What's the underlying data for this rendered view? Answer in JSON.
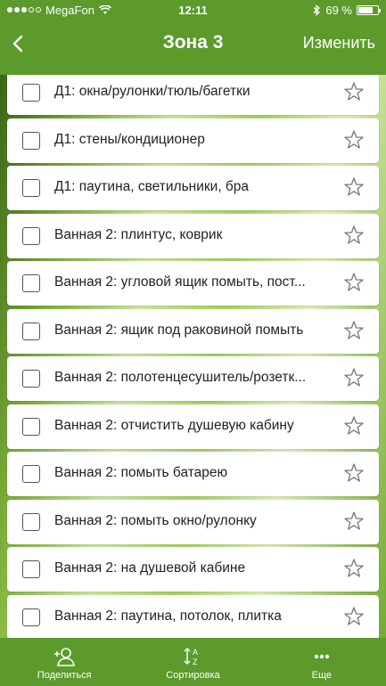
{
  "status": {
    "carrier": "MegaFon",
    "time": "12:11",
    "battery": "69 %",
    "battery_level": 0.69
  },
  "nav": {
    "title": "Зона 3",
    "edit": "Изменить"
  },
  "items": [
    {
      "label": "Д1: окна/рулонки/тюль/багетки"
    },
    {
      "label": "Д1: стены/кондиционер"
    },
    {
      "label": "Д1: паутина, светильники, бра"
    },
    {
      "label": "Ванная 2: плинтус, коврик"
    },
    {
      "label": "Ванная 2: угловой ящик помыть, пост..."
    },
    {
      "label": "Ванная 2: ящик под раковиной помыть"
    },
    {
      "label": "Ванная 2: полотенцесушитель/розетк..."
    },
    {
      "label": "Ванная 2: отчистить душевую кабину"
    },
    {
      "label": "Ванная 2: помыть батарею"
    },
    {
      "label": "Ванная 2: помыть окно/рулонку"
    },
    {
      "label": "Ванная 2: на душевой кабине"
    },
    {
      "label": "Ванная 2: паутина, потолок, плитка"
    }
  ],
  "tabs": {
    "share": "Поделиться",
    "sort": "Сортировка",
    "more": "Еще"
  }
}
